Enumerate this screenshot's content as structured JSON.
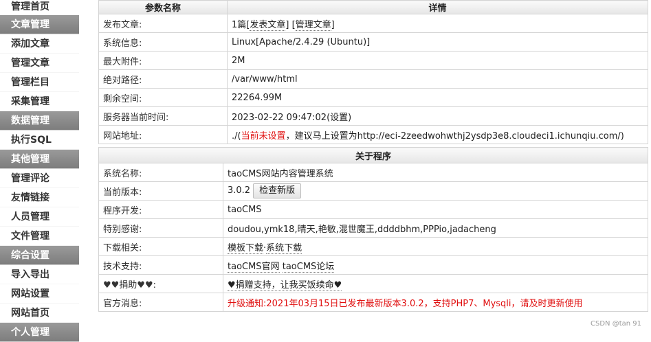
{
  "sidebar": {
    "items": [
      {
        "label": "管理首页",
        "type": "item"
      },
      {
        "label": "文章管理",
        "type": "section"
      },
      {
        "label": "添加文章",
        "type": "item"
      },
      {
        "label": "管理文章",
        "type": "item"
      },
      {
        "label": "管理栏目",
        "type": "item"
      },
      {
        "label": "采集管理",
        "type": "item"
      },
      {
        "label": "数据管理",
        "type": "section"
      },
      {
        "label": "执行SQL",
        "type": "item"
      },
      {
        "label": "其他管理",
        "type": "section"
      },
      {
        "label": "管理评论",
        "type": "item"
      },
      {
        "label": "友情链接",
        "type": "item"
      },
      {
        "label": "人员管理",
        "type": "item"
      },
      {
        "label": "文件管理",
        "type": "item"
      },
      {
        "label": "综合设置",
        "type": "section"
      },
      {
        "label": "导入导出",
        "type": "item"
      },
      {
        "label": "网站设置",
        "type": "item"
      },
      {
        "label": "网站首页",
        "type": "item"
      },
      {
        "label": "个人管理",
        "type": "section"
      }
    ]
  },
  "params_table": {
    "header_name": "参数名称",
    "header_detail": "详情",
    "rows": {
      "articles": {
        "key": "发布文章:",
        "count": "1篇",
        "link_post": "发表文章",
        "link_manage": "管理文章"
      },
      "system": {
        "key": "系统信息:",
        "value": "Linux[Apache/2.4.29 (Ubuntu)]"
      },
      "attach": {
        "key": "最大附件:",
        "value": "2M"
      },
      "path": {
        "key": "绝对路径:",
        "value": "/var/www/html"
      },
      "space": {
        "key": "剩余空间:",
        "value": "22264.99M"
      },
      "time": {
        "key": "服务器当前时间:",
        "value": "2023-02-22 09:47:02",
        "link": "(设置)"
      },
      "url": {
        "key": "网站地址:",
        "prefix": "./(",
        "warn": "当前未设置",
        "suffix": "，建议马上设置为http://eci-2zeedwohwthj2ysdp3e8.cloudeci1.ichunqiu.com/)"
      }
    }
  },
  "about_table": {
    "header": "关于程序",
    "rows": {
      "name": {
        "key": "系统名称:",
        "value": "taoCMS网站内容管理系统"
      },
      "version": {
        "key": "当前版本:",
        "value": "3.0.2",
        "button": "检查新版"
      },
      "dev": {
        "key": "程序开发:",
        "value": "taoCMS"
      },
      "thanks": {
        "key": "特别感谢:",
        "value": "doudou,ymk18,晴天,艳敏,混世魔王,ddddbhm,PPPio,jadacheng"
      },
      "download": {
        "key": "下载相关:",
        "link1": "模板下载",
        "sep": "·",
        "link2": "系统下载"
      },
      "support": {
        "key": "技术支持:",
        "link1": "taoCMS官网",
        "link2": "taoCMS论坛"
      },
      "donate": {
        "key": "♥♥捐助♥♥:",
        "value": "♥捐赠支持，让我买饭续命♥"
      },
      "news": {
        "key": "官方消息:",
        "value": "升级通知:2021年03月15日已发布最新版本3.0.2，支持PHP7、Mysqli，请及时更新使用"
      }
    }
  },
  "watermark": "CSDN @tan 91"
}
